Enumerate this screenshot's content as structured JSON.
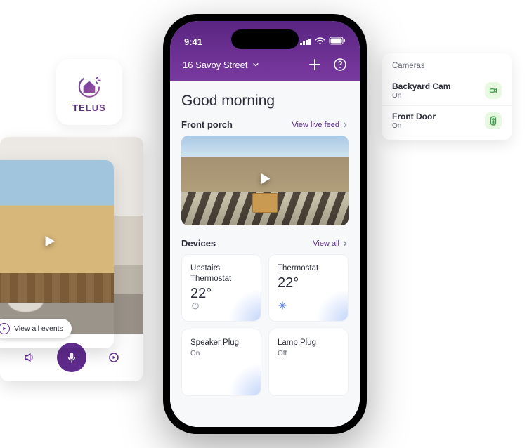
{
  "brand": {
    "name": "TELUS"
  },
  "statusbar": {
    "time": "9:41"
  },
  "header": {
    "address": "16 Savoy Street"
  },
  "greeting": "Good morning",
  "camera_section": {
    "title": "Front porch",
    "link_label": "View live feed"
  },
  "devices_section": {
    "title": "Devices",
    "link_label": "View all",
    "cards": [
      {
        "name": "Upstairs Thermostat",
        "value": "22°"
      },
      {
        "name": "Thermostat",
        "value": "22°"
      },
      {
        "name": "Speaker Plug",
        "sub": "On"
      },
      {
        "name": "Lamp Plug",
        "sub": "Off"
      }
    ]
  },
  "cameras_panel": {
    "title": "Cameras",
    "items": [
      {
        "name": "Backyard Cam",
        "status": "On"
      },
      {
        "name": "Front Door",
        "status": "On"
      }
    ]
  },
  "patio_chip_label": "View all events"
}
